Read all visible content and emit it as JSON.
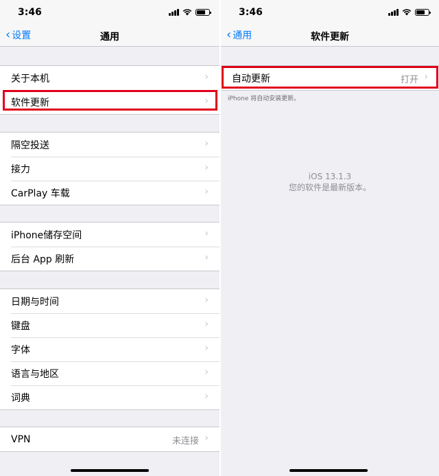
{
  "left": {
    "status": {
      "time": "3:46"
    },
    "nav": {
      "back_label": "设置",
      "title": "通用"
    },
    "groups": [
      {
        "rows": [
          {
            "label": "关于本机"
          },
          {
            "label": "软件更新"
          }
        ]
      },
      {
        "rows": [
          {
            "label": "隔空投送"
          },
          {
            "label": "接力"
          },
          {
            "label": "CarPlay 车载"
          }
        ]
      },
      {
        "rows": [
          {
            "label": "iPhone储存空间"
          },
          {
            "label": "后台 App 刷新"
          }
        ]
      },
      {
        "rows": [
          {
            "label": "日期与时间"
          },
          {
            "label": "键盘"
          },
          {
            "label": "字体"
          },
          {
            "label": "语言与地区"
          },
          {
            "label": "词典"
          }
        ]
      },
      {
        "rows": [
          {
            "label": "VPN",
            "detail": "未连接"
          }
        ]
      }
    ]
  },
  "right": {
    "status": {
      "time": "3:46"
    },
    "nav": {
      "back_label": "通用",
      "title": "软件更新"
    },
    "auto_update": {
      "label": "自动更新",
      "value": "打开"
    },
    "footnote": "iPhone 将自动安装更新。",
    "version": "iOS 13.1.3",
    "version_status": "您的软件是最新版本。"
  },
  "icons": {
    "chevron": "›",
    "back_chevron": "‹"
  },
  "colors": {
    "accent": "#007aff",
    "highlight": "#e0001a",
    "background": "#efeff4"
  }
}
